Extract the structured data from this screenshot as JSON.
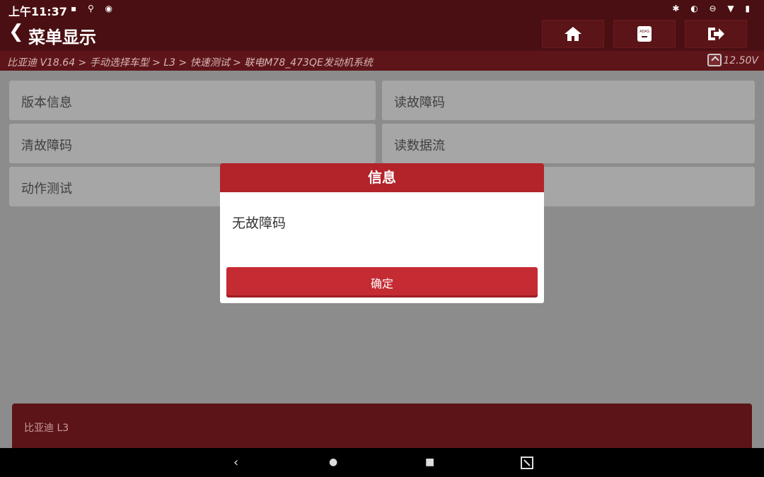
{
  "statusbar": {
    "time": "上午11:37"
  },
  "header": {
    "back_glyph": "❮",
    "title": "菜单显示"
  },
  "header_buttons": [
    {
      "name": "home-icon"
    },
    {
      "name": "adas-icon",
      "label": "ADAS"
    },
    {
      "name": "exit-icon"
    }
  ],
  "breadcrumb": {
    "path": "比亚迪 V18.64 > 手动选择车型 > L3 > 快速测试 > 联电M78_473QE发动机系统",
    "voltage": "12.50V"
  },
  "menu": {
    "items": [
      "版本信息",
      "读故障码",
      "清故障码",
      "读数据流",
      "动作测试"
    ]
  },
  "dialog": {
    "title": "信息",
    "message": "无故障码",
    "ok_label": "确定"
  },
  "bottom": {
    "vehicle": "比亚迪 L3"
  },
  "navbar": {
    "back": "‹",
    "home": "●",
    "recents": "■"
  }
}
